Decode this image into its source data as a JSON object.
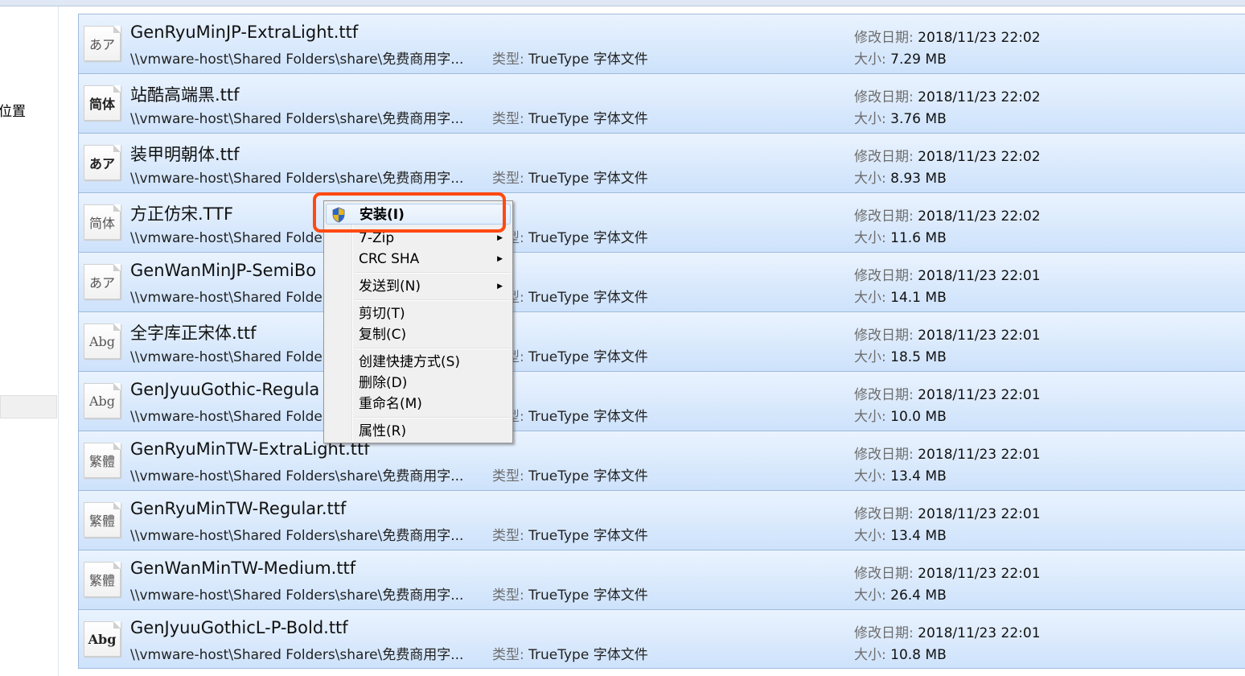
{
  "sidebar": {
    "location_label": "位置"
  },
  "labels": {
    "type": "类型:",
    "modified": "修改日期:",
    "size": "大小:"
  },
  "files": [
    {
      "icon": "あア",
      "icon_style": "light",
      "name": "GenRyuMinJP-ExtraLight.ttf",
      "path": "\\\\vmware-host\\Shared Folders\\share\\免费商用字...",
      "type": "TrueType 字体文件",
      "modified": "2018/11/23 22:02",
      "size": "7.29 MB"
    },
    {
      "icon": "简体",
      "icon_style": "bold",
      "name": "站酷高端黑.ttf",
      "path": "\\\\vmware-host\\Shared Folders\\share\\免费商用字...",
      "type": "TrueType 字体文件",
      "modified": "2018/11/23 22:02",
      "size": "3.76 MB"
    },
    {
      "icon": "あア",
      "icon_style": "bold",
      "name": "装甲明朝体.ttf",
      "path": "\\\\vmware-host\\Shared Folders\\share\\免费商用字...",
      "type": "TrueType 字体文件",
      "modified": "2018/11/23 22:02",
      "size": "8.93 MB"
    },
    {
      "icon": "简体",
      "icon_style": "light",
      "name": "方正仿宋.TTF",
      "path": "\\\\vmware-host\\Shared Folders\\share\\免费商用字...",
      "type": "TrueType 字体文件",
      "modified": "2018/11/23 22:02",
      "size": "11.6 MB"
    },
    {
      "icon": "あア",
      "icon_style": "light",
      "name": "GenWanMinJP-SemiBo",
      "path": "\\\\vmware-host\\Shared Folders\\share\\免费商用字...",
      "type": "TrueType 字体文件",
      "modified": "2018/11/23 22:01",
      "size": "14.1 MB"
    },
    {
      "icon": "Abg",
      "icon_style": "light",
      "name": "全字库正宋体.ttf",
      "path": "\\\\vmware-host\\Shared Folders\\share\\免费商用字...",
      "type": "TrueType 字体文件",
      "modified": "2018/11/23 22:01",
      "size": "18.5 MB"
    },
    {
      "icon": "Abg",
      "icon_style": "light",
      "name": "GenJyuuGothic-Regula",
      "path": "\\\\vmware-host\\Shared Folders\\share\\免费商用字...",
      "type": "TrueType 字体文件",
      "modified": "2018/11/23 22:01",
      "size": "10.0 MB"
    },
    {
      "icon": "繁體",
      "icon_style": "light",
      "name": "GenRyuMinTW-ExtraLight.ttf",
      "path": "\\\\vmware-host\\Shared Folders\\share\\免费商用字...",
      "type": "TrueType 字体文件",
      "modified": "2018/11/23 22:01",
      "size": "13.4 MB"
    },
    {
      "icon": "繁體",
      "icon_style": "light",
      "name": "GenRyuMinTW-Regular.ttf",
      "path": "\\\\vmware-host\\Shared Folders\\share\\免费商用字...",
      "type": "TrueType 字体文件",
      "modified": "2018/11/23 22:01",
      "size": "13.4 MB"
    },
    {
      "icon": "繁體",
      "icon_style": "light",
      "name": "GenWanMinTW-Medium.ttf",
      "path": "\\\\vmware-host\\Shared Folders\\share\\免费商用字...",
      "type": "TrueType 字体文件",
      "modified": "2018/11/23 22:01",
      "size": "26.4 MB"
    },
    {
      "icon": "Abg",
      "icon_style": "bold",
      "name": "GenJyuuGothicL-P-Bold.ttf",
      "path": "\\\\vmware-host\\Shared Folders\\share\\免费商用字...",
      "type": "TrueType 字体文件",
      "modified": "2018/11/23 22:01",
      "size": "10.8 MB"
    }
  ],
  "context_menu": {
    "items": [
      {
        "label": "安装(I)",
        "icon": "uac-shield-icon",
        "highlighted": true
      },
      {
        "label": "7-Zip",
        "submenu": true
      },
      {
        "label": "CRC SHA",
        "submenu": true
      },
      {
        "label": "发送到(N)",
        "submenu": true
      },
      {
        "label": "剪切(T)"
      },
      {
        "label": "复制(C)"
      },
      {
        "label": "创建快捷方式(S)"
      },
      {
        "label": "删除(D)"
      },
      {
        "label": "重命名(M)"
      },
      {
        "label": "属性(R)"
      }
    ]
  },
  "colors": {
    "highlight_box": "#ff4a12",
    "row_top": "#eaf3fe",
    "row_bottom": "#cde2fb"
  }
}
